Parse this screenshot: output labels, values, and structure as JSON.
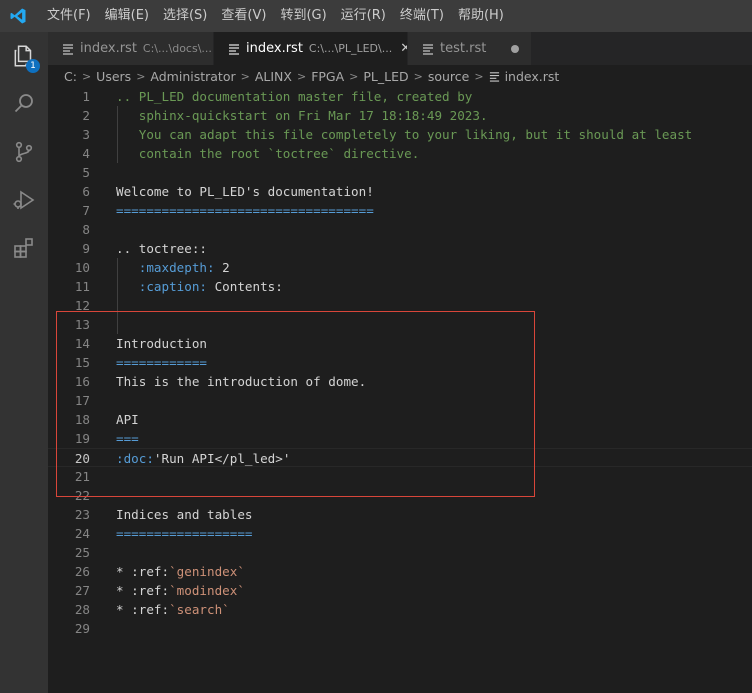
{
  "menu": {
    "items": [
      "文件(F)",
      "编辑(E)",
      "选择(S)",
      "查看(V)",
      "转到(G)",
      "运行(R)",
      "终端(T)",
      "帮助(H)"
    ]
  },
  "activity": {
    "explorer_badge": "1"
  },
  "tabs": [
    {
      "name": "index.rst",
      "desc": "C:\\...\\docs\\...",
      "active": false,
      "dirty": false
    },
    {
      "name": "index.rst",
      "desc": "C:\\...\\PL_LED\\...",
      "active": true,
      "close": "✕"
    },
    {
      "name": "test.rst",
      "desc": "",
      "active": false,
      "dirty": true
    }
  ],
  "breadcrumb": [
    "C:",
    "Users",
    "Administrator",
    "ALINX",
    "FPGA",
    "PL_LED",
    "source",
    "index.rst"
  ],
  "editor": {
    "current_line": 20,
    "lines": [
      {
        "n": "1",
        "tokens": [
          {
            "t": ".. PL_LED documentation master file, created by",
            "c": "c-comment"
          }
        ]
      },
      {
        "n": "2",
        "tokens": [
          {
            "t": "   sphinx-quickstart on Fri Mar 17 18:18:49 2023.",
            "c": "c-comment"
          }
        ]
      },
      {
        "n": "3",
        "tokens": [
          {
            "t": "   You can adapt this file completely to your liking, but it should at least",
            "c": "c-comment"
          }
        ]
      },
      {
        "n": "4",
        "tokens": [
          {
            "t": "   contain the root `toctree` directive.",
            "c": "c-comment"
          }
        ]
      },
      {
        "n": "5",
        "tokens": []
      },
      {
        "n": "6",
        "tokens": [
          {
            "t": "Welcome to PL_LED's documentation!",
            "c": "c-heading"
          }
        ]
      },
      {
        "n": "7",
        "tokens": [
          {
            "t": "==================================",
            "c": "c-underline"
          }
        ]
      },
      {
        "n": "8",
        "tokens": []
      },
      {
        "n": "9",
        "tokens": [
          {
            "t": ".. toctree::",
            "c": "c-text"
          }
        ]
      },
      {
        "n": "10",
        "tokens": [
          {
            "t": "   ",
            "c": "c-text"
          },
          {
            "t": ":maxdepth:",
            "c": "c-field"
          },
          {
            "t": " 2",
            "c": "c-value"
          }
        ]
      },
      {
        "n": "11",
        "tokens": [
          {
            "t": "   ",
            "c": "c-text"
          },
          {
            "t": ":caption:",
            "c": "c-field"
          },
          {
            "t": " Contents:",
            "c": "c-value"
          }
        ]
      },
      {
        "n": "12",
        "tokens": []
      },
      {
        "n": "13",
        "tokens": []
      },
      {
        "n": "14",
        "tokens": [
          {
            "t": "Introduction",
            "c": "c-heading"
          }
        ]
      },
      {
        "n": "15",
        "tokens": [
          {
            "t": "============",
            "c": "c-underline"
          }
        ]
      },
      {
        "n": "16",
        "tokens": [
          {
            "t": "This is the introduction of dome.",
            "c": "c-text"
          }
        ]
      },
      {
        "n": "17",
        "tokens": []
      },
      {
        "n": "18",
        "tokens": [
          {
            "t": "API",
            "c": "c-heading"
          }
        ]
      },
      {
        "n": "19",
        "tokens": [
          {
            "t": "===",
            "c": "c-underline"
          }
        ]
      },
      {
        "n": "20",
        "tokens": [
          {
            "t": ":doc:",
            "c": "c-role"
          },
          {
            "t": "'Run API</pl_led>'",
            "c": "c-text"
          }
        ]
      },
      {
        "n": "21",
        "tokens": []
      },
      {
        "n": "22",
        "tokens": []
      },
      {
        "n": "23",
        "tokens": [
          {
            "t": "Indices and tables",
            "c": "c-heading"
          }
        ]
      },
      {
        "n": "24",
        "tokens": [
          {
            "t": "==================",
            "c": "c-underline"
          }
        ]
      },
      {
        "n": "25",
        "tokens": []
      },
      {
        "n": "26",
        "tokens": [
          {
            "t": "* ",
            "c": "c-bullet"
          },
          {
            "t": ":ref:",
            "c": "c-text"
          },
          {
            "t": "`genindex`",
            "c": "c-string"
          }
        ]
      },
      {
        "n": "27",
        "tokens": [
          {
            "t": "* ",
            "c": "c-bullet"
          },
          {
            "t": ":ref:",
            "c": "c-text"
          },
          {
            "t": "`modindex`",
            "c": "c-string"
          }
        ]
      },
      {
        "n": "28",
        "tokens": [
          {
            "t": "* ",
            "c": "c-bullet"
          },
          {
            "t": ":ref:",
            "c": "c-text"
          },
          {
            "t": "`search`",
            "c": "c-string"
          }
        ]
      },
      {
        "n": "29",
        "tokens": []
      }
    ]
  },
  "colors": {
    "highlight_box": "#d9463a",
    "accent": "#0e70c0"
  }
}
